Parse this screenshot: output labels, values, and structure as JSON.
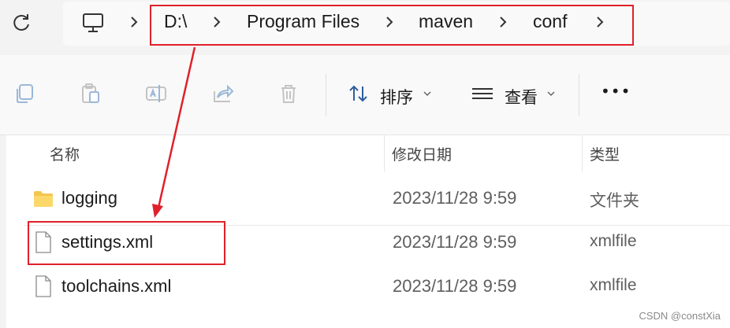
{
  "address_bar": {
    "crumbs": [
      "D:\\",
      "Program Files",
      "maven",
      "conf"
    ]
  },
  "toolbar": {
    "sort_label": "排序",
    "view_label": "查看",
    "more_label": "•••"
  },
  "file_list": {
    "headers": {
      "name": "名称",
      "date": "修改日期",
      "type": "类型"
    },
    "rows": [
      {
        "name": "logging",
        "date": "2023/11/28 9:59",
        "type": "文件夹",
        "icon": "folder-icon"
      },
      {
        "name": "settings.xml",
        "date": "2023/11/28 9:59",
        "type": "xmlfile",
        "icon": "file-icon"
      },
      {
        "name": "toolchains.xml",
        "date": "2023/11/28 9:59",
        "type": "xmlfile",
        "icon": "file-icon"
      }
    ]
  },
  "annotation": {
    "highlight_color": "#e0202a"
  },
  "watermark": "CSDN @constXia"
}
